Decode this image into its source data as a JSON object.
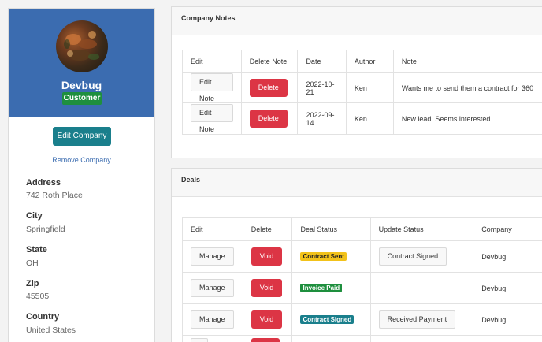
{
  "company": {
    "name": "Devbug",
    "badge": "Customer",
    "edit_label": "Edit Company",
    "remove_label": "Remove Company",
    "fields": [
      {
        "label": "Address",
        "value": "742 Roth Place"
      },
      {
        "label": "City",
        "value": "Springfield"
      },
      {
        "label": "State",
        "value": "OH"
      },
      {
        "label": "Zip",
        "value": "45505"
      },
      {
        "label": "Country",
        "value": "United States"
      }
    ]
  },
  "notes": {
    "title": "Company Notes",
    "columns": [
      "Edit",
      "Delete Note",
      "Date",
      "Author",
      "Note"
    ],
    "rows": [
      {
        "edit": "Edit Note",
        "delete": "Delete",
        "date": "2022-10-21",
        "author": "Ken",
        "note": "Wants me to send them a contract for 360"
      },
      {
        "edit": "Edit Note",
        "delete": "Delete",
        "date": "2022-09-14",
        "author": "Ken",
        "note": "New lead. Seems interested"
      }
    ]
  },
  "deals": {
    "title": "Deals",
    "columns": [
      "Edit",
      "Delete",
      "Deal Status",
      "Update Status",
      "Company"
    ],
    "rows": [
      {
        "edit": "Manage",
        "delete": "Void",
        "status": "Contract Sent",
        "status_color": "#f2c21a",
        "update": "Contract Signed",
        "company": "Devbug"
      },
      {
        "edit": "Manage",
        "delete": "Void",
        "status": "Invoice Paid",
        "status_color": "#1e8f3e",
        "update": "",
        "company": "Devbug"
      },
      {
        "edit": "Manage",
        "delete": "Void",
        "status": "Contract Signed",
        "status_color": "#1a7f8c",
        "update": "Received Payment",
        "company": "Devbug"
      }
    ]
  },
  "colors": {
    "header_blue": "#3b6cb0",
    "customer_green": "#1e8f3e",
    "teal": "#1a7f8c",
    "danger": "#dc3545"
  }
}
